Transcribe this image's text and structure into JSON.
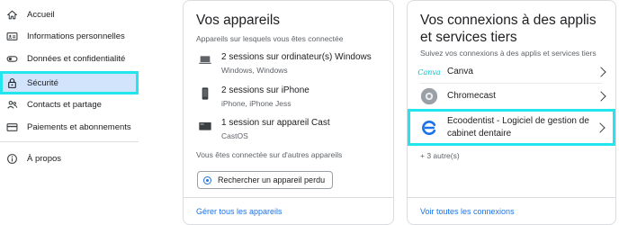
{
  "sidebar": {
    "items": [
      {
        "label": "Accueil",
        "icon": "home-icon"
      },
      {
        "label": "Informations personnelles",
        "icon": "id-card-icon"
      },
      {
        "label": "Données et confidentialité",
        "icon": "toggle-icon"
      },
      {
        "label": "Sécurité",
        "icon": "lock-icon",
        "active": true
      },
      {
        "label": "Contacts et partage",
        "icon": "people-icon"
      },
      {
        "label": "Paiements et abonnements",
        "icon": "credit-card-icon"
      },
      {
        "label": "À propos",
        "icon": "info-icon"
      }
    ]
  },
  "devices_card": {
    "title": "Vos appareils",
    "subtitle": "Appareils sur lesquels vous êtes connectée",
    "devices": [
      {
        "main": "2 sessions sur ordinateur(s) Windows",
        "sub": "Windows, Windows",
        "icon": "laptop-icon"
      },
      {
        "main": "2 sessions sur iPhone",
        "sub": "iPhone, iPhone Jess",
        "icon": "phone-icon"
      },
      {
        "main": "1 session sur appareil Cast",
        "sub": "CastOS",
        "icon": "cast-device-icon"
      }
    ],
    "other_devices_text": "Vous êtes connectée sur d'autres appareils",
    "find_device_button": "Rechercher un appareil perdu",
    "footer_link": "Gérer tous les appareils"
  },
  "connections_card": {
    "title": "Vos connexions à des applis et services tiers",
    "subtitle": "Suivez vos connexions à des applis et services tiers",
    "apps": [
      {
        "name": "Canva",
        "icon": "canva-logo-icon",
        "logo_text": "Canva"
      },
      {
        "name": "Chromecast",
        "icon": "chromecast-logo-icon"
      },
      {
        "name": "Ecoodentist - Logiciel de gestion de cabinet dentaire",
        "icon": "ecoodentist-logo-icon"
      }
    ],
    "more_text": "+ 3 autre(s)",
    "footer_link": "Voir toutes les connexions"
  },
  "colors": {
    "highlight": "#22e6ee",
    "active_bg": "#d2e3fc",
    "link": "#1a73e8"
  }
}
